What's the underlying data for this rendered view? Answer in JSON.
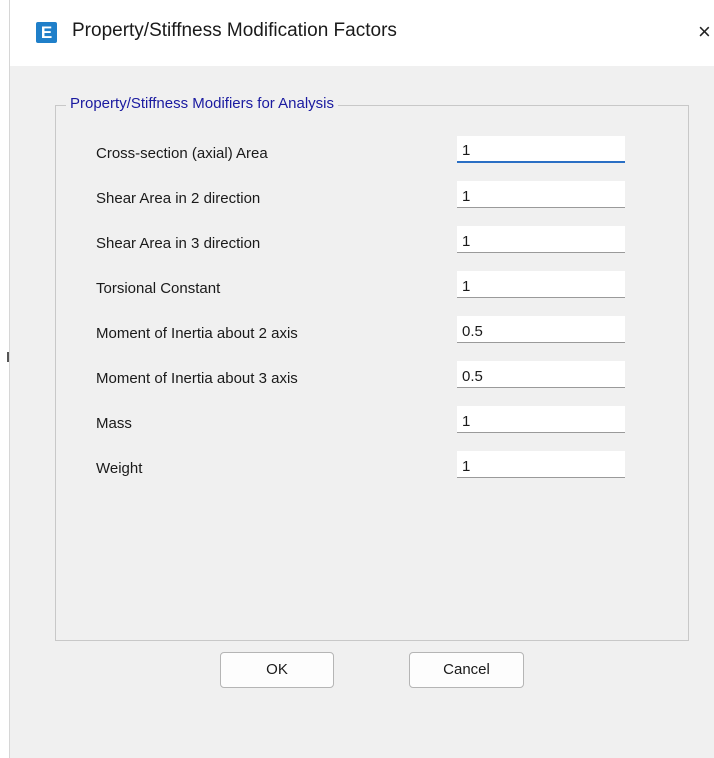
{
  "window": {
    "title": "Property/Stiffness Modification Factors",
    "app_icon_letter": "E",
    "close_glyph": "×"
  },
  "groupbox": {
    "label": "Property/Stiffness Modifiers for Analysis"
  },
  "fields": [
    {
      "label": "Cross-section (axial) Area",
      "value": "1",
      "focused": true
    },
    {
      "label": "Shear Area in 2 direction",
      "value": "1"
    },
    {
      "label": "Shear Area in 3 direction",
      "value": "1"
    },
    {
      "label": "Torsional Constant",
      "value": "1"
    },
    {
      "label": "Moment of Inertia about 2 axis",
      "value": "0.5"
    },
    {
      "label": "Moment of Inertia about 3 axis",
      "value": "0.5"
    },
    {
      "label": "Mass",
      "value": "1"
    },
    {
      "label": "Weight",
      "value": "1"
    }
  ],
  "buttons": {
    "ok_label": "OK",
    "cancel_label": "Cancel"
  },
  "colors": {
    "accent_icon": "#1f7fc9",
    "group_label": "#1a1aa0",
    "focus_underline": "#2a6fc4"
  },
  "icons": {
    "app_icon": "etabs-app-icon",
    "close": "close-icon"
  }
}
